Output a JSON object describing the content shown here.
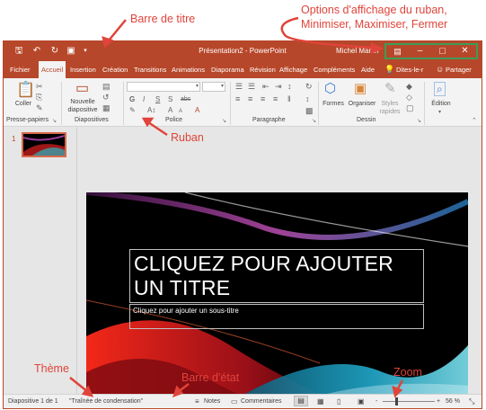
{
  "annotations": {
    "title_bar": "Barre de titre",
    "ribbon_options_line1": "Options d'affichage du ruban,",
    "ribbon_options_line2": "Minimiser, Maximiser, Fermer",
    "ribbon": "Ruban",
    "theme": "Thème",
    "status_bar": "Barre d'état",
    "zoom": "Zoom"
  },
  "titlebar": {
    "document_title": "Présentation2 - PowerPoint",
    "user": "Michel Martin",
    "icons": [
      "save-icon",
      "undo-icon",
      "redo-icon",
      "present-icon",
      "customize-icon"
    ],
    "window_controls": [
      "ribbon-display-options-icon",
      "minimize-icon",
      "maximize-icon",
      "close-icon"
    ]
  },
  "tabs": [
    "Fichier",
    "Accueil",
    "Insertion",
    "Création",
    "Transitions",
    "Animations",
    "Diaporama",
    "Révision",
    "Affichage",
    "Compléments",
    "Aide"
  ],
  "active_tab": "Accueil",
  "tell_me": "Dites-le-r",
  "share": "Partager",
  "ribbon": {
    "paste": "Coller",
    "new_slide_line1": "Nouvelle",
    "new_slide_line2": "diapositive",
    "shapes": "Formes",
    "arrange": "Organiser",
    "quick_styles_line1": "Styles",
    "quick_styles_line2": "rapides",
    "editing": "Édition",
    "font_bold": "G",
    "font_italic": "I",
    "font_underline": "S",
    "font_strike": "S",
    "font_abc": "abc",
    "groups": [
      "Presse-papiers",
      "Diapositives",
      "Police",
      "Paragraphe",
      "Dessin"
    ]
  },
  "thumbnails": {
    "slide_number": "1"
  },
  "slide": {
    "title_placeholder": "CLIQUEZ POUR AJOUTER UN TITRE",
    "subtitle_placeholder": "Cliquez pour ajouter un sous-titre"
  },
  "statusbar": {
    "slide_info": "Diapositive 1 de 1",
    "theme_name": "\"Traînée de condensation\"",
    "notes": "Notes",
    "comments": "Commentaires",
    "zoom_minus": "-",
    "zoom_plus": "+",
    "zoom_level": "56 %",
    "zoom_fraction": 0.56
  },
  "colors": {
    "accent": "#b7472a",
    "annotation": "#e0443a",
    "highlight_box": "#3e9b57"
  }
}
